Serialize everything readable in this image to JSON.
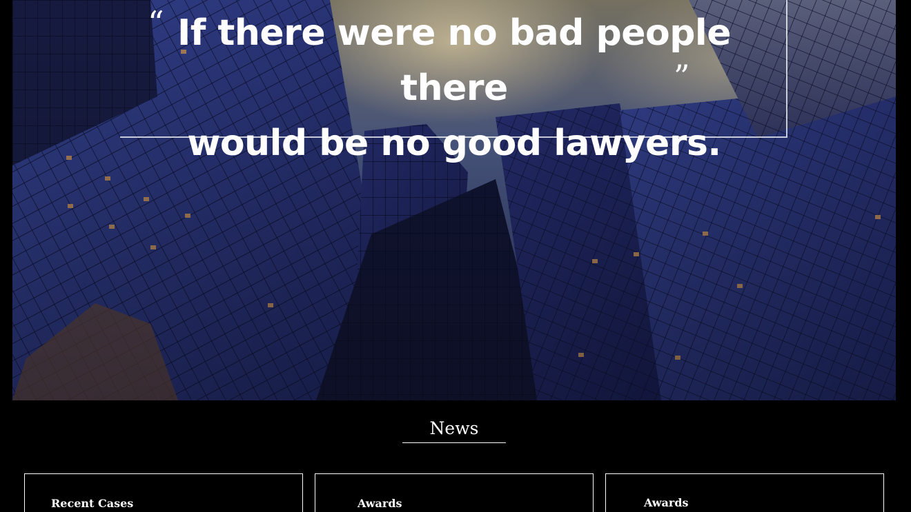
{
  "hero": {
    "quote_open_mark": "“",
    "quote_line_1": "If there were no bad people there",
    "quote_line_2": "would be no good lawyers.",
    "quote_close_mark": "”",
    "background_image": "glass-skyscrapers-photo"
  },
  "news": {
    "title": "News",
    "cards": [
      {
        "title": "Recent Cases"
      },
      {
        "title": "Awards"
      },
      {
        "title": "Awards"
      }
    ]
  },
  "colors": {
    "page_background": "#000000",
    "text": "#ffffff",
    "frame_line": "#ffffff"
  }
}
